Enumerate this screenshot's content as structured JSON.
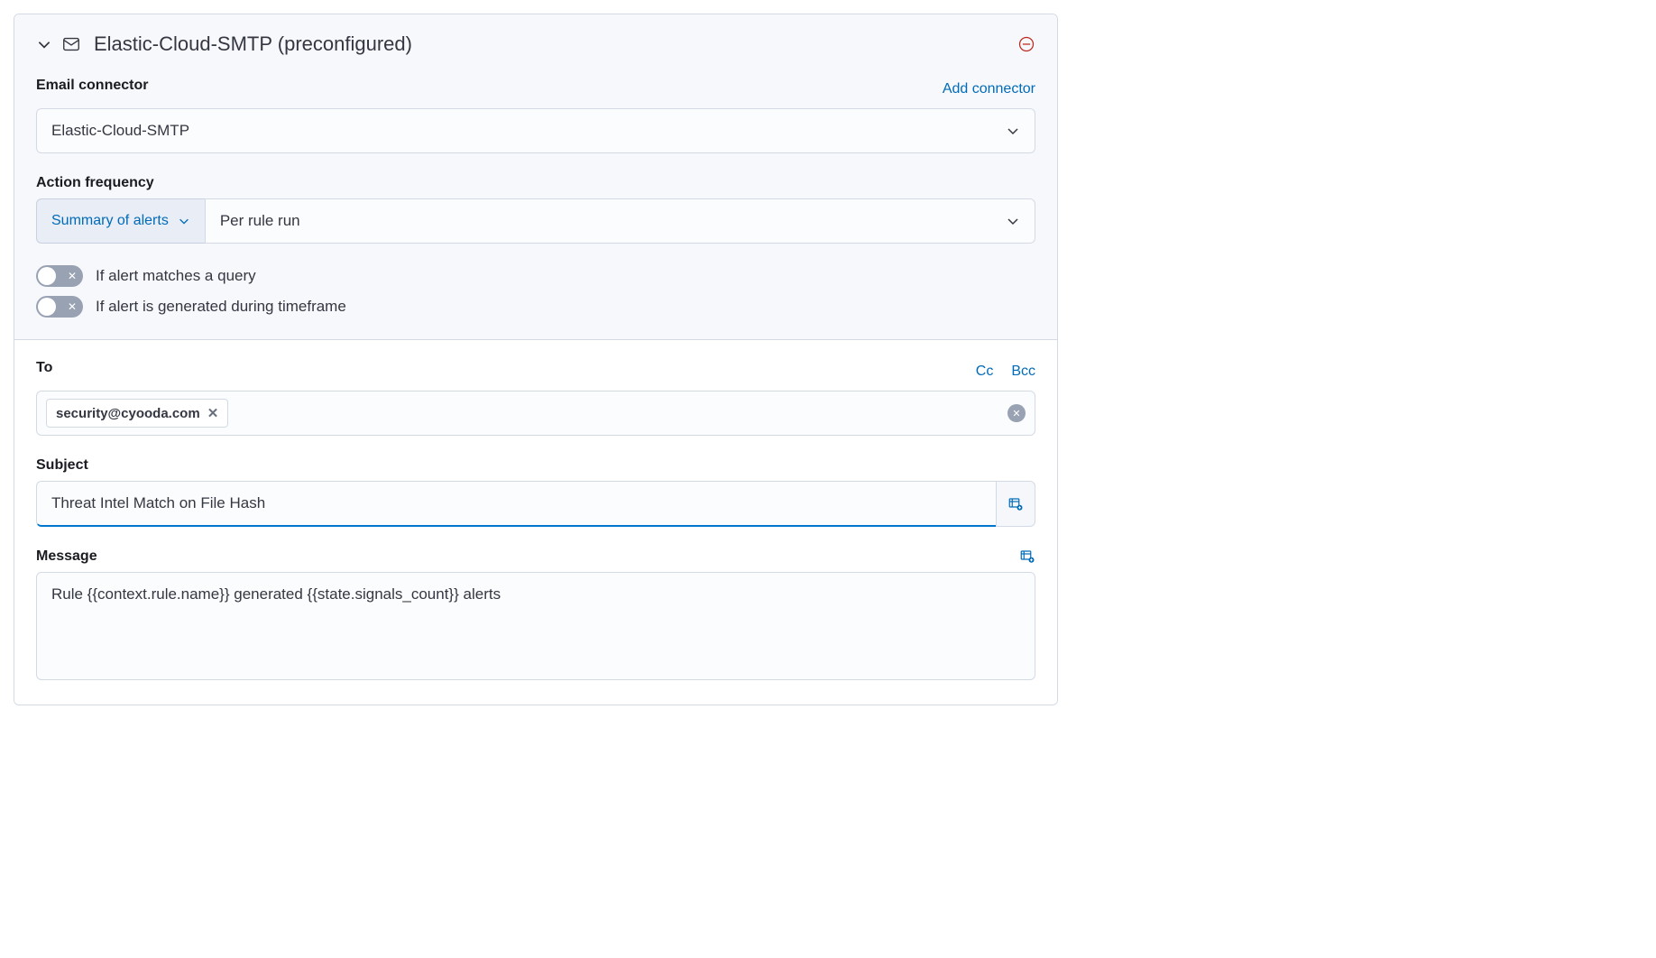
{
  "header": {
    "title": "Elastic-Cloud-SMTP (preconfigured)"
  },
  "connector": {
    "label": "Email connector",
    "addLink": "Add connector",
    "selected": "Elastic-Cloud-SMTP"
  },
  "frequency": {
    "label": "Action frequency",
    "summary": "Summary of alerts",
    "perRule": "Per rule run"
  },
  "toggles": {
    "query": "If alert matches a query",
    "timeframe": "If alert is generated during timeframe"
  },
  "to": {
    "label": "To",
    "cc": "Cc",
    "bcc": "Bcc",
    "pill": "security@cyooda.com"
  },
  "subject": {
    "label": "Subject",
    "value": "Threat Intel Match on File Hash"
  },
  "message": {
    "label": "Message",
    "value": "Rule {{context.rule.name}} generated {{state.signals_count}} alerts"
  }
}
